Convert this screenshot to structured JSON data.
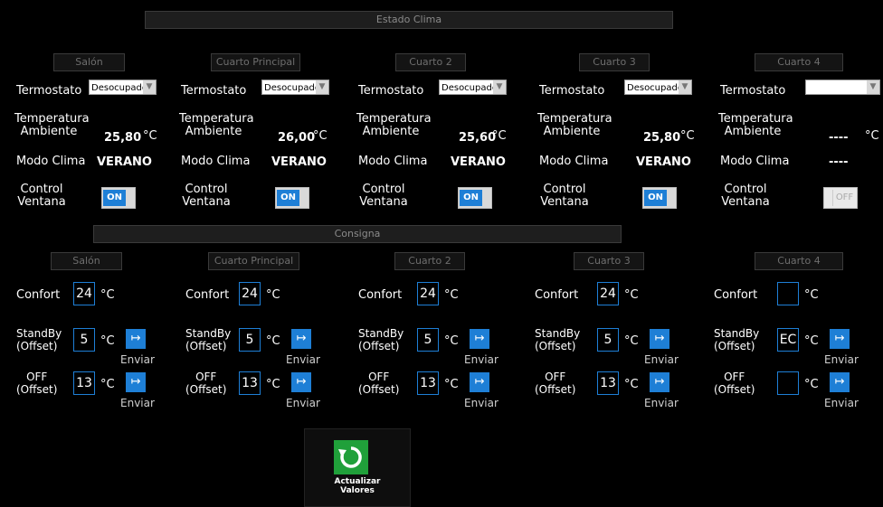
{
  "estado_clima": {
    "title": "Estado Clima",
    "labels": {
      "termostato": "Termostato",
      "temp_line1": "Temperatura",
      "temp_line2": "Ambiente",
      "modo": "Modo Clima",
      "ctrl_line1": "Control",
      "ctrl_line2": "Ventana"
    },
    "rooms": [
      {
        "name": "Salón",
        "termostato": "Desocupado",
        "temperatura": "25,80",
        "unit": "°C",
        "modo": "VERANO",
        "ventana": "ON"
      },
      {
        "name": "Cuarto Principal",
        "termostato": "Desocupado",
        "temperatura": "26,00",
        "unit": "°C",
        "modo": "VERANO",
        "ventana": "ON"
      },
      {
        "name": "Cuarto 2",
        "termostato": "Desocupado",
        "temperatura": "25,60",
        "unit": "°C",
        "modo": "VERANO",
        "ventana": "ON"
      },
      {
        "name": "Cuarto 3",
        "termostato": "Desocupado",
        "temperatura": "25,80",
        "unit": "°C",
        "modo": "VERANO",
        "ventana": "ON"
      },
      {
        "name": "Cuarto 4",
        "termostato": "",
        "temperatura": "----",
        "unit": "°C",
        "modo": "----",
        "ventana": "OFF"
      }
    ]
  },
  "consigna": {
    "title": "Consigna",
    "labels": {
      "confort": "Confort",
      "standby_line1": "StandBy",
      "standby_line2": "(Offset)",
      "off_line1": "OFF",
      "off_line2": "(Offset)",
      "unit": "°C",
      "enviar": "Enviar"
    },
    "rooms": [
      {
        "name": "Salón",
        "confort": "24",
        "standby": "5",
        "off": "13"
      },
      {
        "name": "Cuarto Principal",
        "confort": "24",
        "standby": "5",
        "off": "13"
      },
      {
        "name": "Cuarto 2",
        "confort": "24",
        "standby": "5",
        "off": "13"
      },
      {
        "name": "Cuarto 3",
        "confort": "24",
        "standby": "5",
        "off": "13"
      },
      {
        "name": "Cuarto 4",
        "confort": "",
        "standby": "EC",
        "off": ""
      }
    ]
  },
  "refresh": {
    "line1": "Actualizar",
    "line2": "Valores"
  },
  "colors": {
    "accent": "#1e7fd6",
    "refresh_green": "#20a03a",
    "background": "#000000"
  },
  "icons": {
    "send": "send-icon",
    "refresh": "refresh-icon",
    "dropdown": "chevron-down-icon"
  }
}
